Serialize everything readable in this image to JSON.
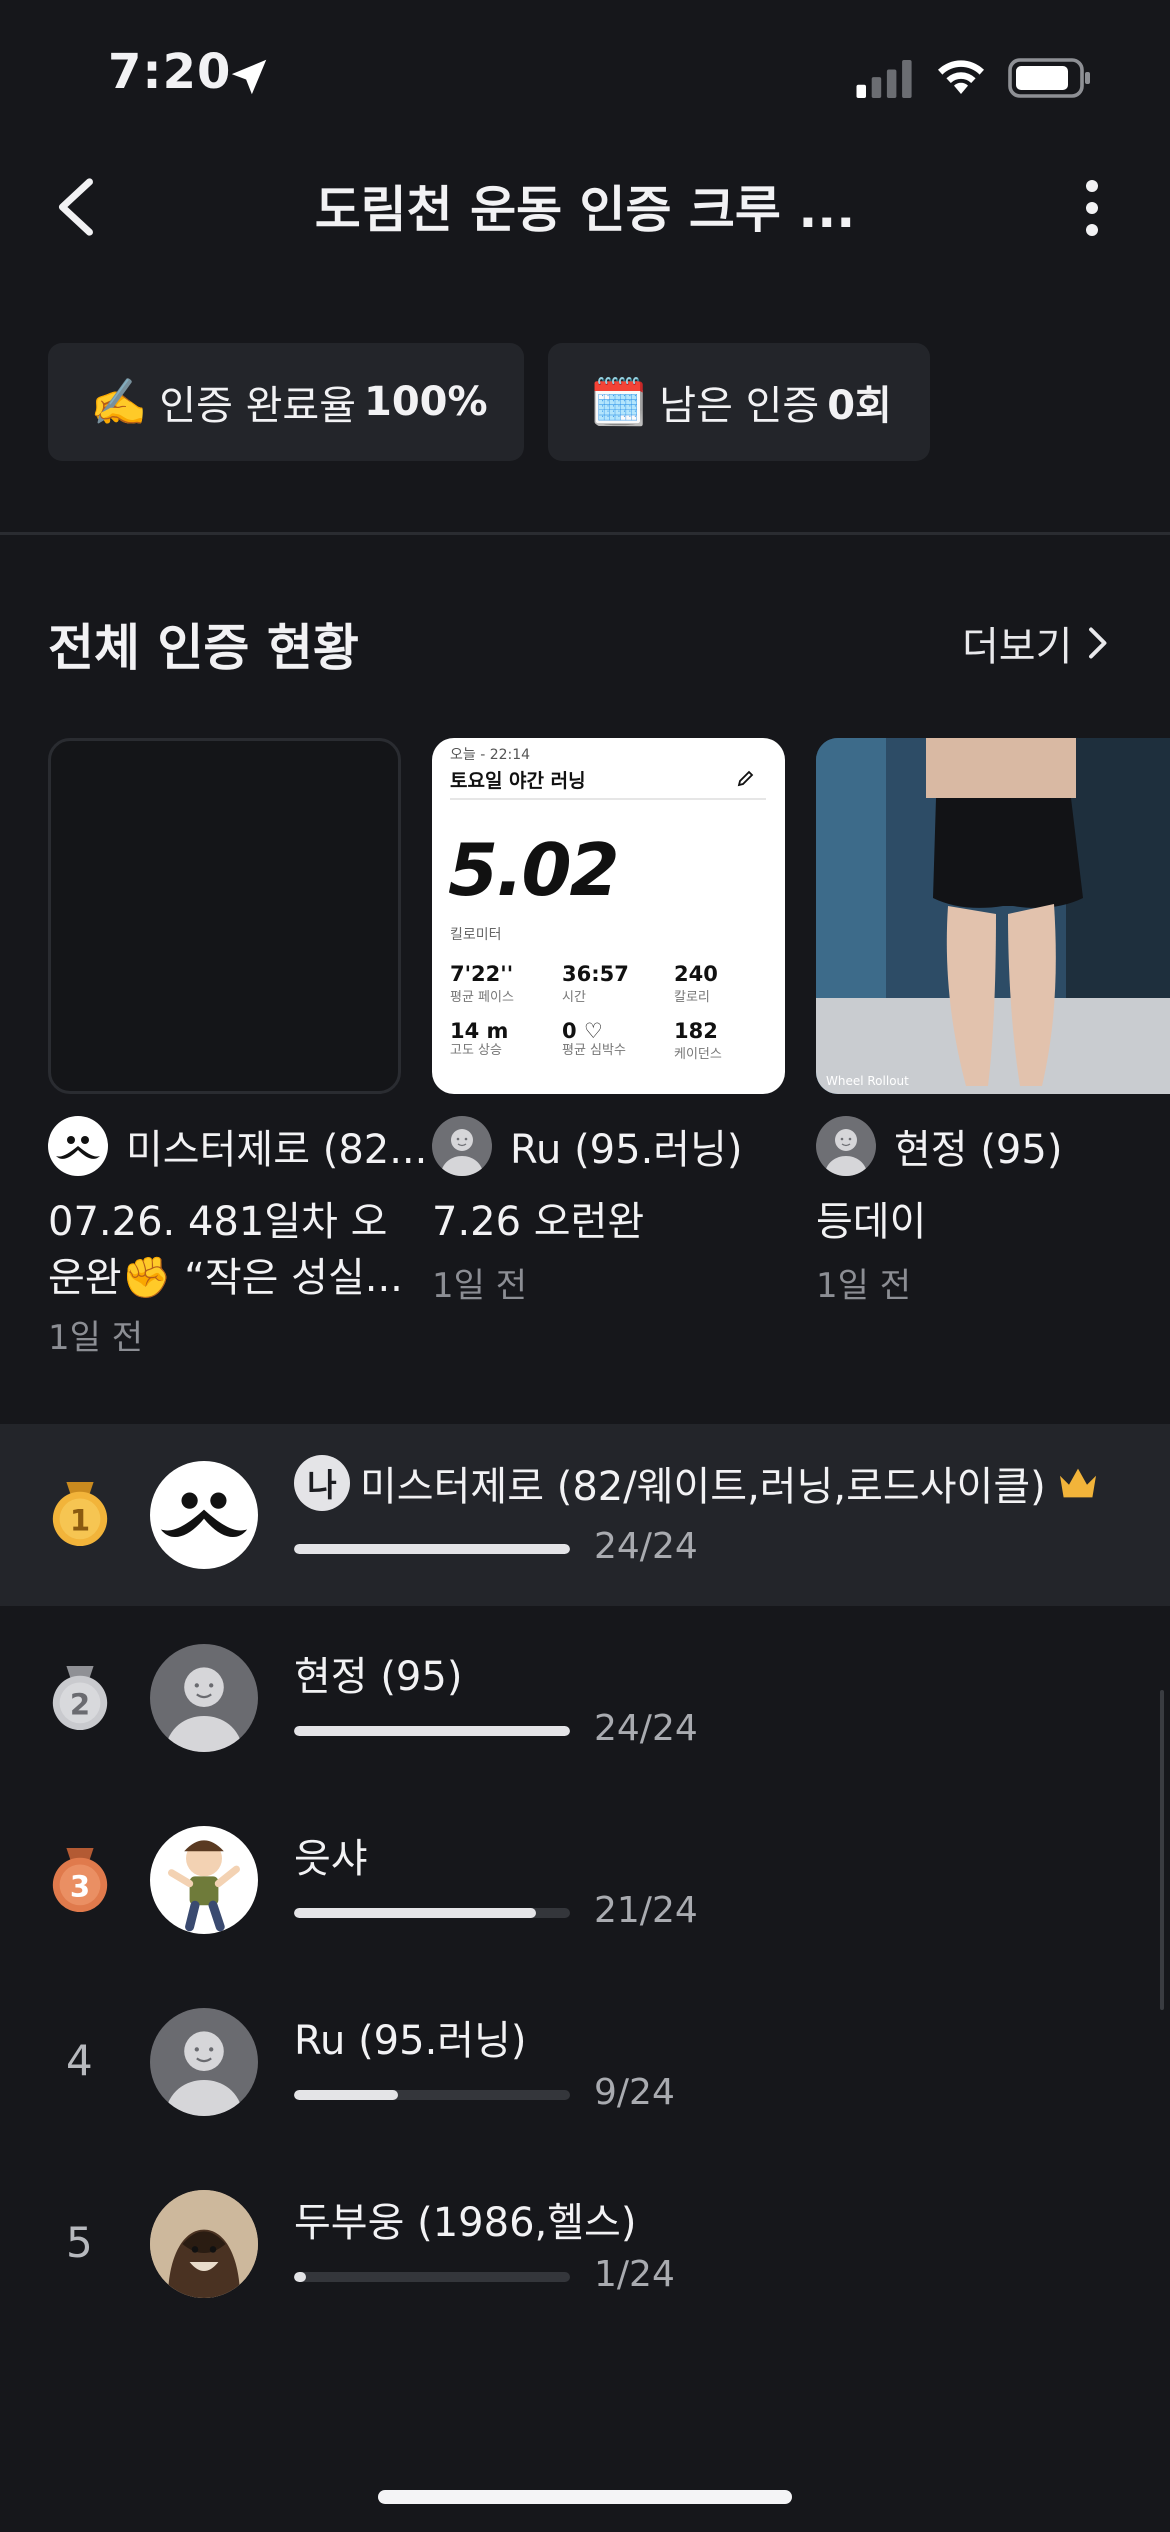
{
  "status_bar": {
    "time": "7:20"
  },
  "header": {
    "title": "도림천 운동 인증 크루 ..."
  },
  "stats": {
    "completion": {
      "emoji": "✍️",
      "label": "인증 완료율",
      "value": "100%"
    },
    "remaining": {
      "emoji": "🗓️",
      "label": "남은 인증",
      "value": "0회"
    }
  },
  "section": {
    "title": "전체 인증 현황",
    "more_label": "더보기"
  },
  "posts": [
    {
      "author": "미스터제로 (82...",
      "text1": "07.26. 481일차 오",
      "text2": "운완✊ “작은 성실...",
      "time": "1일 전"
    },
    {
      "author": "Ru (95.러닝)",
      "text1": "7.26 오런완",
      "time": "1일 전",
      "workout": {
        "date": "오늘 - 22:14",
        "name": "토요일 야간 러닝",
        "distance": "5.02",
        "distance_unit": "킬로미터",
        "stats": [
          {
            "value": "7'22''",
            "label": "평균 페이스"
          },
          {
            "value": "36:57",
            "label": "시간"
          },
          {
            "value": "240",
            "label": "칼로리"
          },
          {
            "value": "14 m",
            "label": "고도 상승"
          },
          {
            "value": "0 ♡",
            "label": "평균 심박수"
          },
          {
            "value": "182",
            "label": "케이던스"
          }
        ]
      }
    },
    {
      "author": "현정 (95)",
      "text1": "등데이",
      "time": "1일 전",
      "photo_caption": "Wheel Rollout"
    }
  ],
  "ranking": [
    {
      "rank": "1",
      "me_badge": "나",
      "name": "미스터제로 (82/웨이트,러닝,로드사이클)",
      "count": "24/24",
      "progress": 1.0,
      "crown": true
    },
    {
      "rank": "2",
      "name": "현정 (95)",
      "count": "24/24",
      "progress": 1.0
    },
    {
      "rank": "3",
      "name": "읏샤",
      "count": "21/24",
      "progress": 0.875
    },
    {
      "rank": "4",
      "name": "Ru (95.러닝)",
      "count": "9/24",
      "progress": 0.375
    },
    {
      "rank": "5",
      "name": "두부웅 (1986,헬스)",
      "count": "1/24",
      "progress": 0.0417
    }
  ],
  "colors": {
    "background": "#16171b",
    "surface": "#23252a",
    "gold": "#f2b43a",
    "silver": "#c9cace",
    "bronze": "#e07a4c"
  }
}
